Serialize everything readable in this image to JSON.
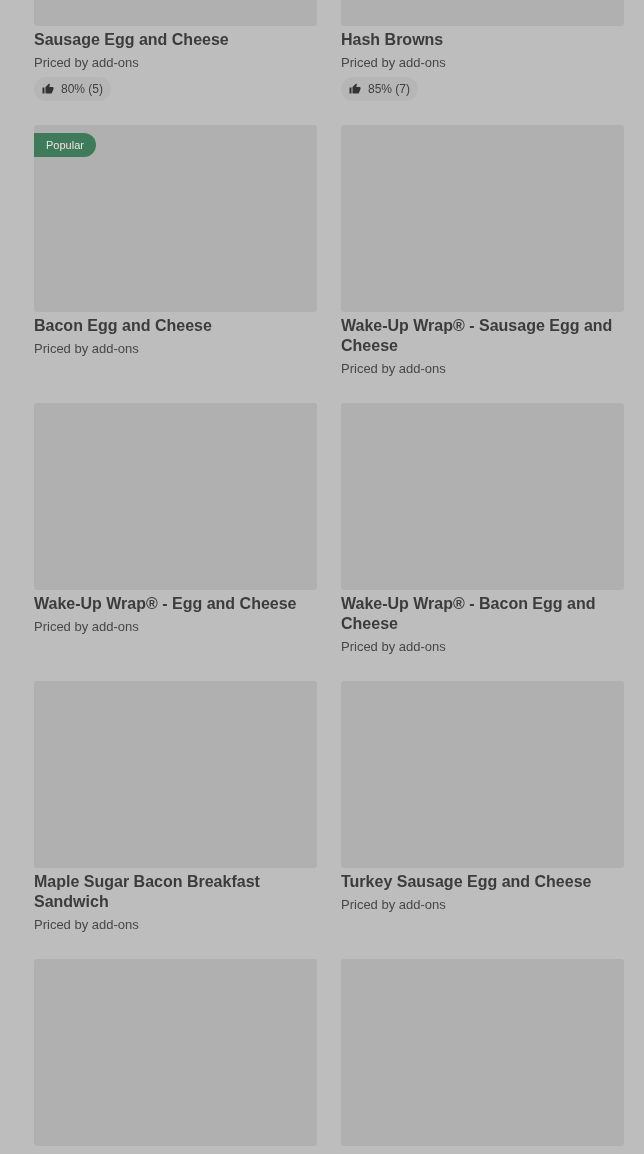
{
  "items": [
    {
      "kind": "product",
      "title": "Sausage Egg and Cheese",
      "subtitle": "Priced by add-ons",
      "rating": "80% (5)"
    },
    {
      "kind": "product",
      "title": "Hash Browns",
      "subtitle": "Priced by add-ons",
      "rating": "85% (7)"
    },
    {
      "kind": "product",
      "title": "Bacon Egg and Cheese",
      "subtitle": "Priced by add-ons",
      "badge": "Popular"
    },
    {
      "kind": "product",
      "title": "Wake-Up Wrap® - Sausage Egg and Cheese",
      "subtitle": "Priced by add-ons"
    },
    {
      "kind": "product",
      "title": "Wake-Up Wrap® - Egg and Cheese",
      "subtitle": "Priced by add-ons"
    },
    {
      "kind": "product",
      "title": "Wake-Up Wrap® - Bacon Egg and Cheese",
      "subtitle": "Priced by add-ons"
    },
    {
      "kind": "product",
      "title": "Maple Sugar Bacon Breakfast Sandwich",
      "subtitle": "Priced by add-ons"
    },
    {
      "kind": "product",
      "title": "Turkey Sausage Egg and Cheese",
      "subtitle": "Priced by add-ons"
    },
    {
      "kind": "image_only"
    },
    {
      "kind": "image_only"
    }
  ]
}
